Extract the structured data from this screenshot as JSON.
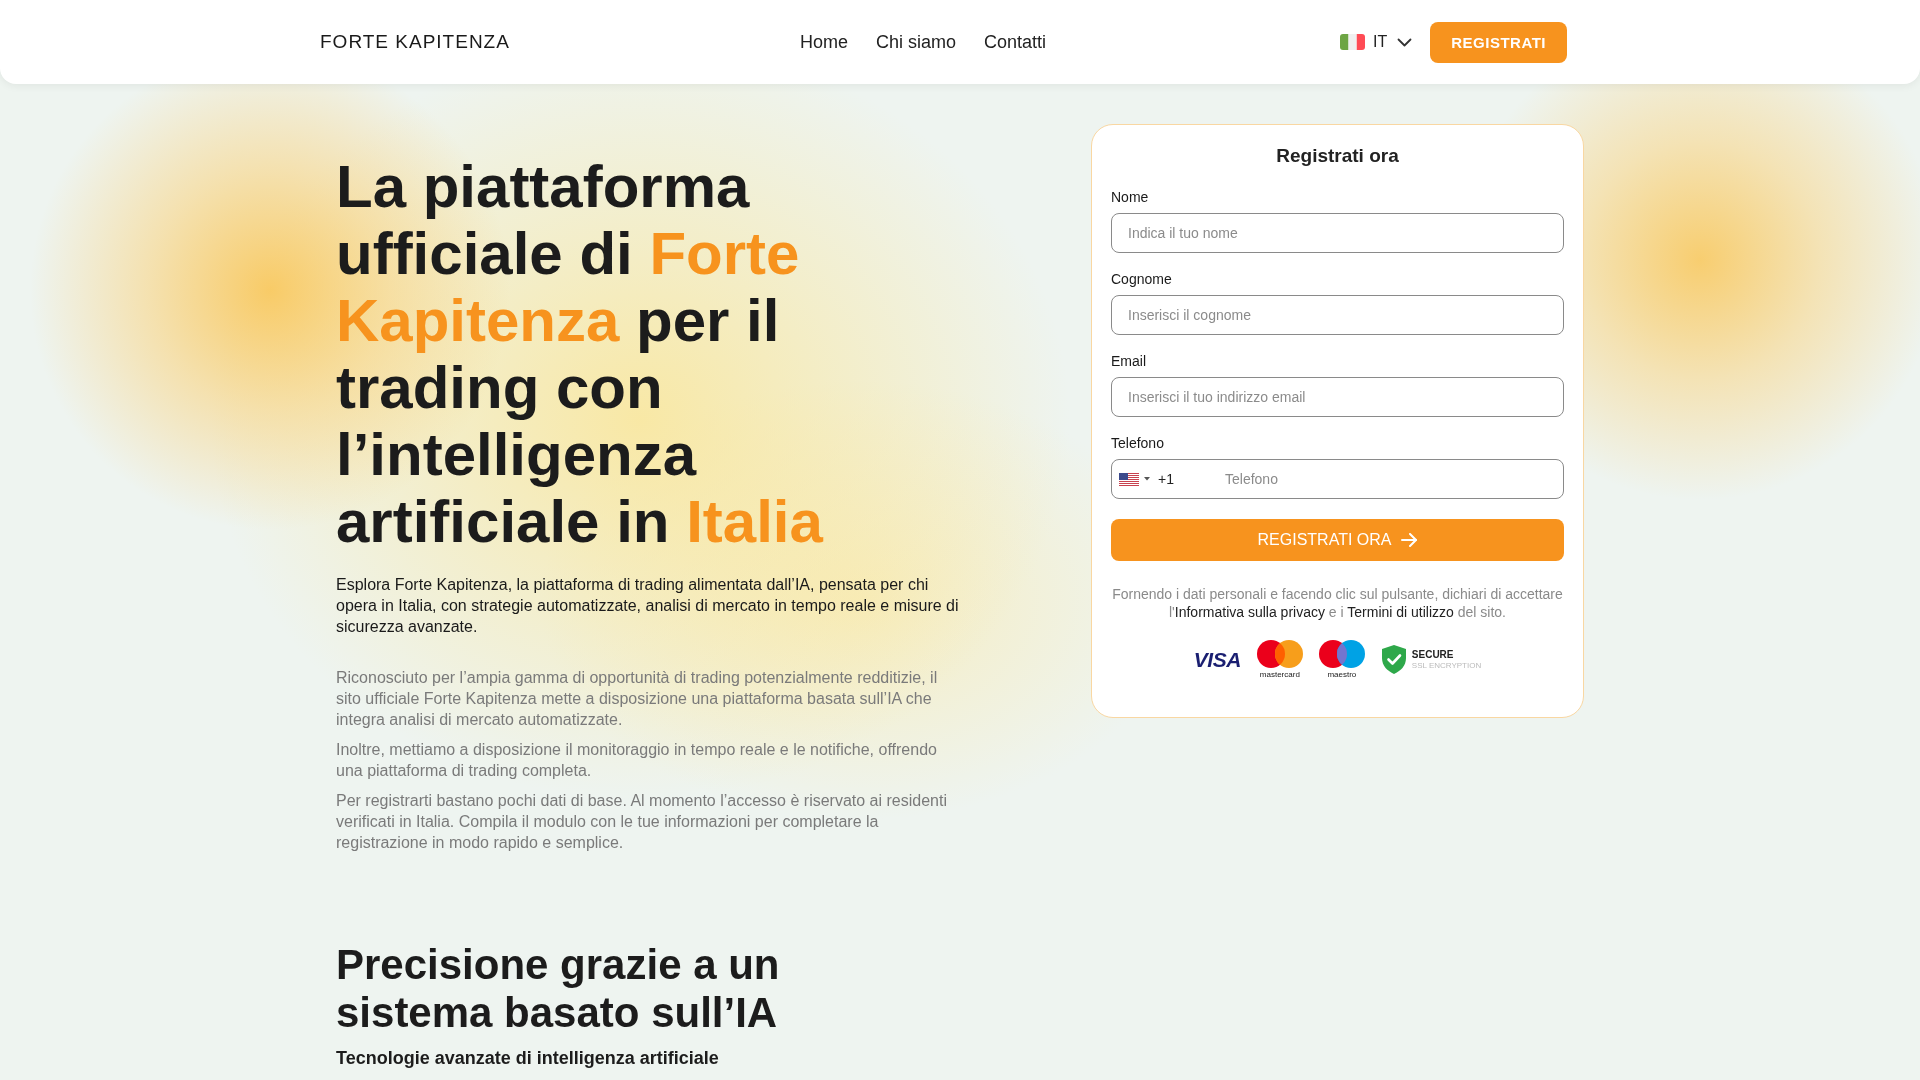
{
  "header": {
    "logo": "FORTE KAPITENZA",
    "nav": [
      {
        "label": "Home"
      },
      {
        "label": "Chi siamo"
      },
      {
        "label": "Contatti"
      }
    ],
    "language": {
      "code": "IT"
    },
    "cta": "REGISTRATI"
  },
  "hero": {
    "heading": [
      {
        "text": "La piattaforma ufficiale di ",
        "highlight": false
      },
      {
        "text": "Forte Kapitenza",
        "highlight": true
      },
      {
        "text": " per il trading con l’intelligenza artificiale in ",
        "highlight": false
      },
      {
        "text": "Italia",
        "highlight": true
      }
    ],
    "lead": "Esplora Forte Kapitenza, la piattaforma di trading alimentata dall’IA, pensata per chi opera in Italia, con strategie automatizzate, analisi di mercato in tempo reale e misure di sicurezza avanzate.",
    "paragraphs": [
      "Riconosciuto per l’ampia gamma di opportunità di trading potenzialmente redditizie, il sito ufficiale Forte Kapitenza mette a disposizione una piattaforma basata sull’IA che integra analisi di mercato automatizzate.",
      "Inoltre, mettiamo a disposizione il monitoraggio in tempo reale e le notifiche, offrendo una piattaforma di trading completa.",
      "Per registrarti bastano pochi dati di base. Al momento l’accesso è riservato ai residenti verificati in Italia. Compila il modulo con le tue informazioni per completare la registrazione in modo rapido e semplice."
    ]
  },
  "form": {
    "title": "Registrati ora",
    "fields": [
      {
        "kind": "text",
        "label": "Nome",
        "placeholder": "Indica il tuo nome"
      },
      {
        "kind": "text",
        "label": "Cognome",
        "placeholder": "Inserisci il cognome"
      },
      {
        "kind": "text",
        "label": "Email",
        "placeholder": "Inserisci il tuo indirizzo email"
      },
      {
        "kind": "phone",
        "label": "Telefono",
        "dial_code": "+1",
        "placeholder": "Telefono"
      }
    ],
    "submit": "REGISTRATI ORA",
    "consent": [
      {
        "kind": "text",
        "text": "Fornendo i dati personali e facendo clic sul pulsante, dichiari di accettare l'"
      },
      {
        "kind": "link",
        "text": "Informativa sulla privacy"
      },
      {
        "kind": "text",
        "text": " e i "
      },
      {
        "kind": "link",
        "text": "Termini di utilizzo"
      },
      {
        "kind": "text",
        "text": " del sito."
      }
    ],
    "badges": [
      {
        "kind": "visa",
        "label": "VISA"
      },
      {
        "kind": "mastercard",
        "label": "mastercard"
      },
      {
        "kind": "maestro",
        "label": "maestro"
      },
      {
        "kind": "secure",
        "label": "SECURE",
        "caption": "SSL ENCRYPTION"
      }
    ]
  },
  "features": {
    "heading": "Precisione grazie a un sistema basato sull’IA",
    "subheading": "Tecnologie avanzate di intelligenza artificiale"
  }
}
